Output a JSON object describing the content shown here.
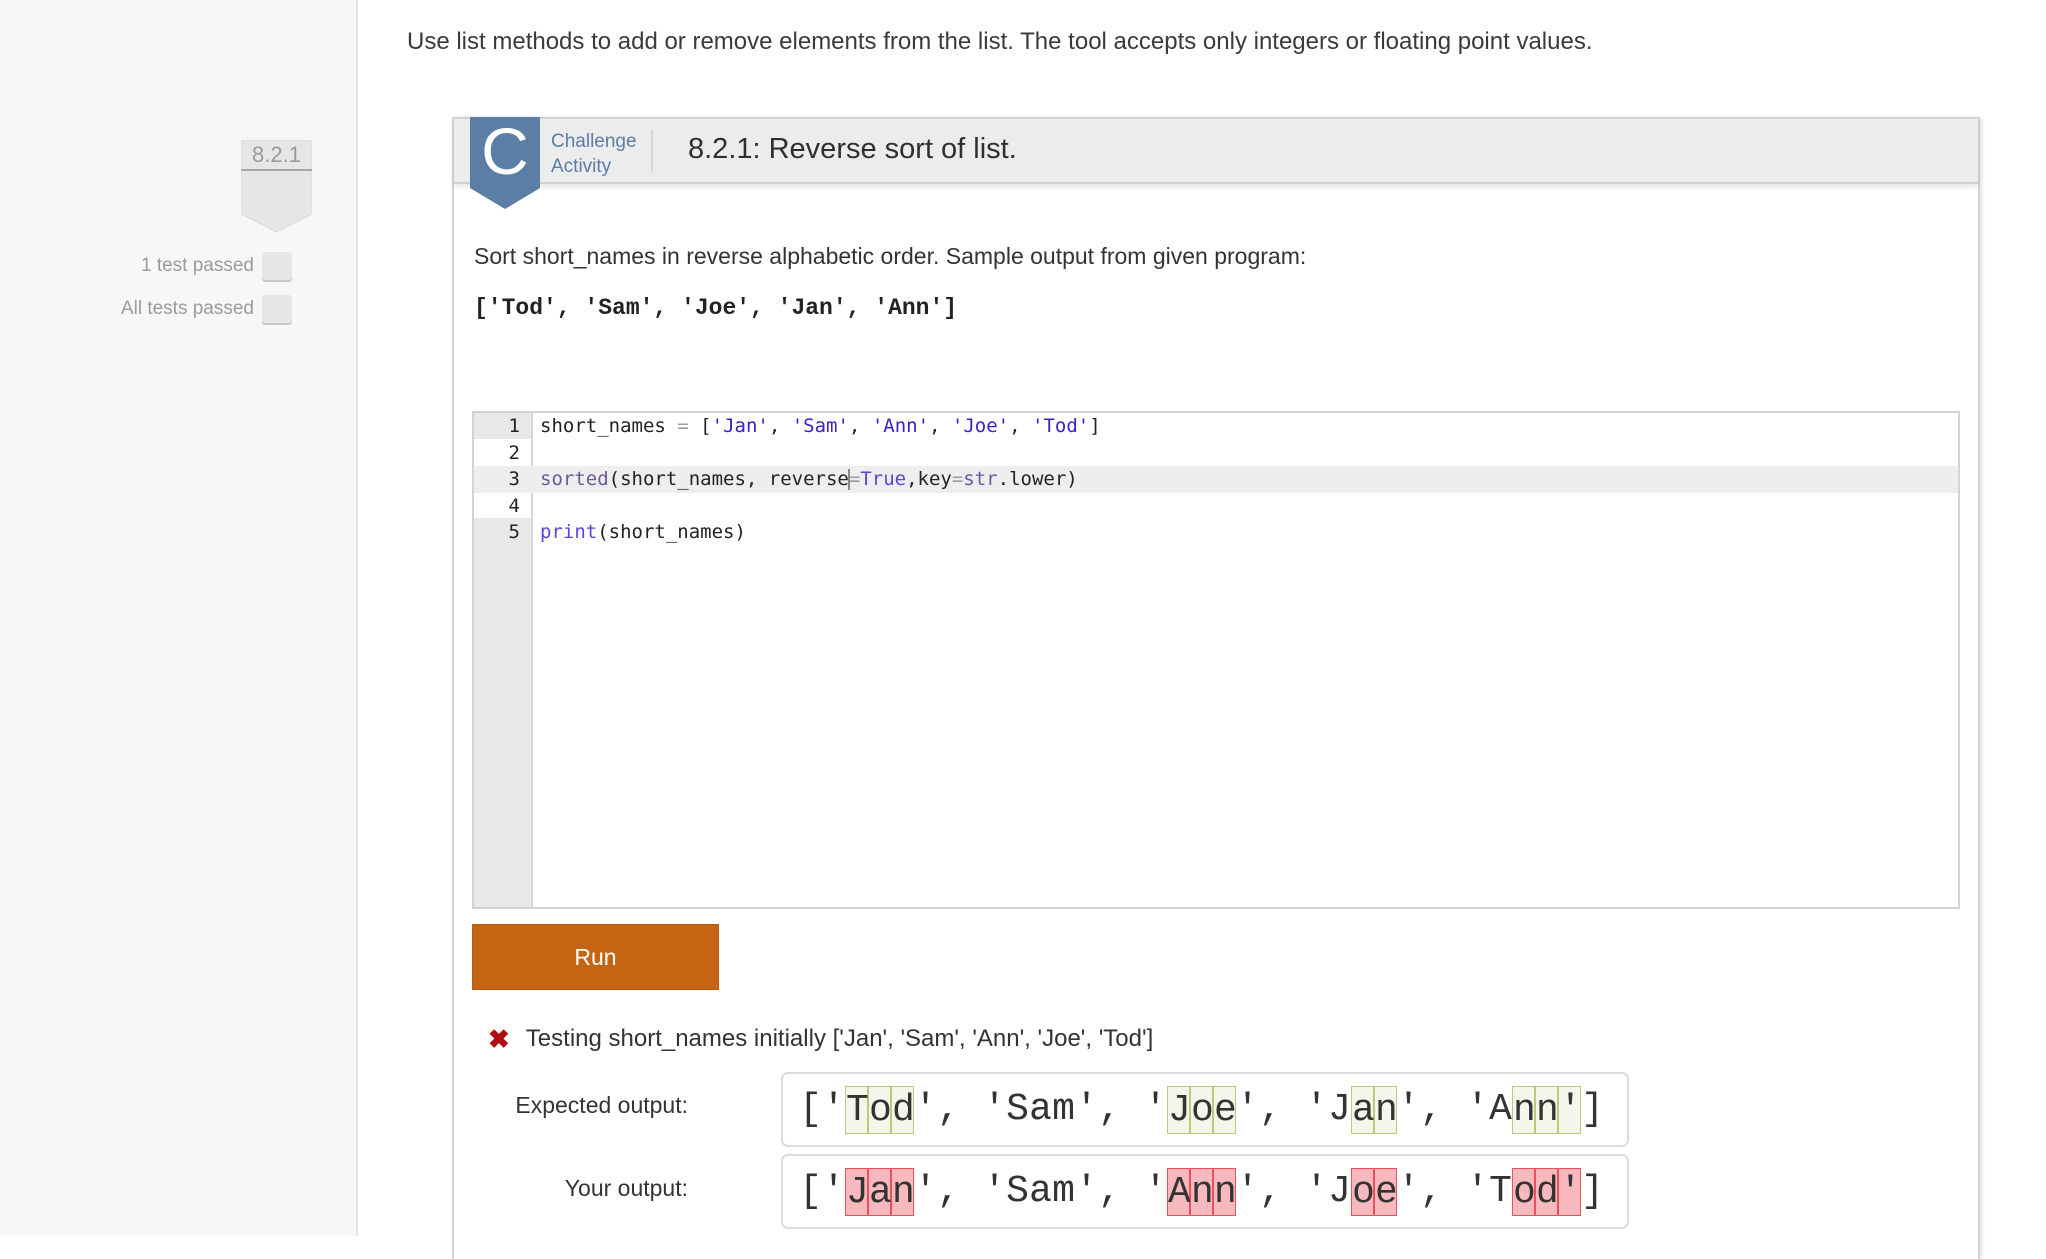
{
  "sidebar": {
    "section_number": "8.2.1",
    "progress": [
      {
        "label": "1 test passed",
        "checked": false
      },
      {
        "label": "All tests passed",
        "checked": false
      }
    ]
  },
  "intro_text": "Use list methods to add or remove elements from the list. The tool accepts only integers or floating point values.",
  "card": {
    "badge_letter": "C",
    "activity_type_line1": "Challenge",
    "activity_type_line2": "Activity",
    "title": "8.2.1: Reverse sort of list.",
    "instructions": "Sort short_names in reverse alphabetic order. Sample output from given program:",
    "sample_output": "['Tod', 'Sam', 'Joe', 'Jan', 'Ann']",
    "editor": {
      "active_line": 3,
      "lines": [
        {
          "number": "1",
          "tokens": [
            {
              "t": "short_names ",
              "c": "plain"
            },
            {
              "t": "=",
              "c": "op"
            },
            {
              "t": " [",
              "c": "plain"
            },
            {
              "t": "'Jan'",
              "c": "string"
            },
            {
              "t": ", ",
              "c": "plain"
            },
            {
              "t": "'Sam'",
              "c": "string"
            },
            {
              "t": ", ",
              "c": "plain"
            },
            {
              "t": "'Ann'",
              "c": "string"
            },
            {
              "t": ", ",
              "c": "plain"
            },
            {
              "t": "'Joe'",
              "c": "string"
            },
            {
              "t": ", ",
              "c": "plain"
            },
            {
              "t": "'Tod'",
              "c": "string"
            },
            {
              "t": "]",
              "c": "plain"
            }
          ]
        },
        {
          "number": "2",
          "tokens": []
        },
        {
          "number": "3",
          "tokens": [
            {
              "t": "sorted",
              "c": "builtin"
            },
            {
              "t": "(short_names, reverse",
              "c": "plain"
            },
            {
              "t": "|",
              "c": "cursor"
            },
            {
              "t": "=",
              "c": "op"
            },
            {
              "t": "True",
              "c": "keyword"
            },
            {
              "t": ",key",
              "c": "plain"
            },
            {
              "t": "=",
              "c": "op"
            },
            {
              "t": "str",
              "c": "builtin"
            },
            {
              "t": ".lower)",
              "c": "plain"
            }
          ]
        },
        {
          "number": "4",
          "tokens": []
        },
        {
          "number": "5",
          "tokens": [
            {
              "t": "print",
              "c": "keyword"
            },
            {
              "t": "(short_names)",
              "c": "plain"
            }
          ]
        }
      ]
    },
    "run_label": "Run",
    "test": {
      "status": "failed",
      "status_icon": "x-mark-icon",
      "description": "Testing short_names initially ['Jan', 'Sam', 'Ann', 'Joe', 'Tod']",
      "expected_label": "Expected output:",
      "your_label": "Your output:",
      "expected_output": "['Tod', 'Sam', 'Joe', 'Jan', 'Ann']",
      "your_output": "['Jan', 'Sam', 'Ann', 'Joe', 'Tod']",
      "expected_diff_indices": [
        2,
        3,
        4,
        16,
        17,
        18,
        24,
        25,
        31,
        32,
        33
      ],
      "your_diff_indices": [
        2,
        3,
        4,
        16,
        17,
        18,
        24,
        25,
        31,
        32,
        33
      ]
    }
  },
  "colors": {
    "accent_blue": "#5b7ea6",
    "run_button": "#c56514",
    "fail_red": "#b00d12",
    "diff_ok_bg": "#f4f6ec",
    "diff_ok_border": "#b4cd78",
    "diff_bad_bg": "#f8b9be",
    "diff_bad_border": "#ef4f5a"
  }
}
